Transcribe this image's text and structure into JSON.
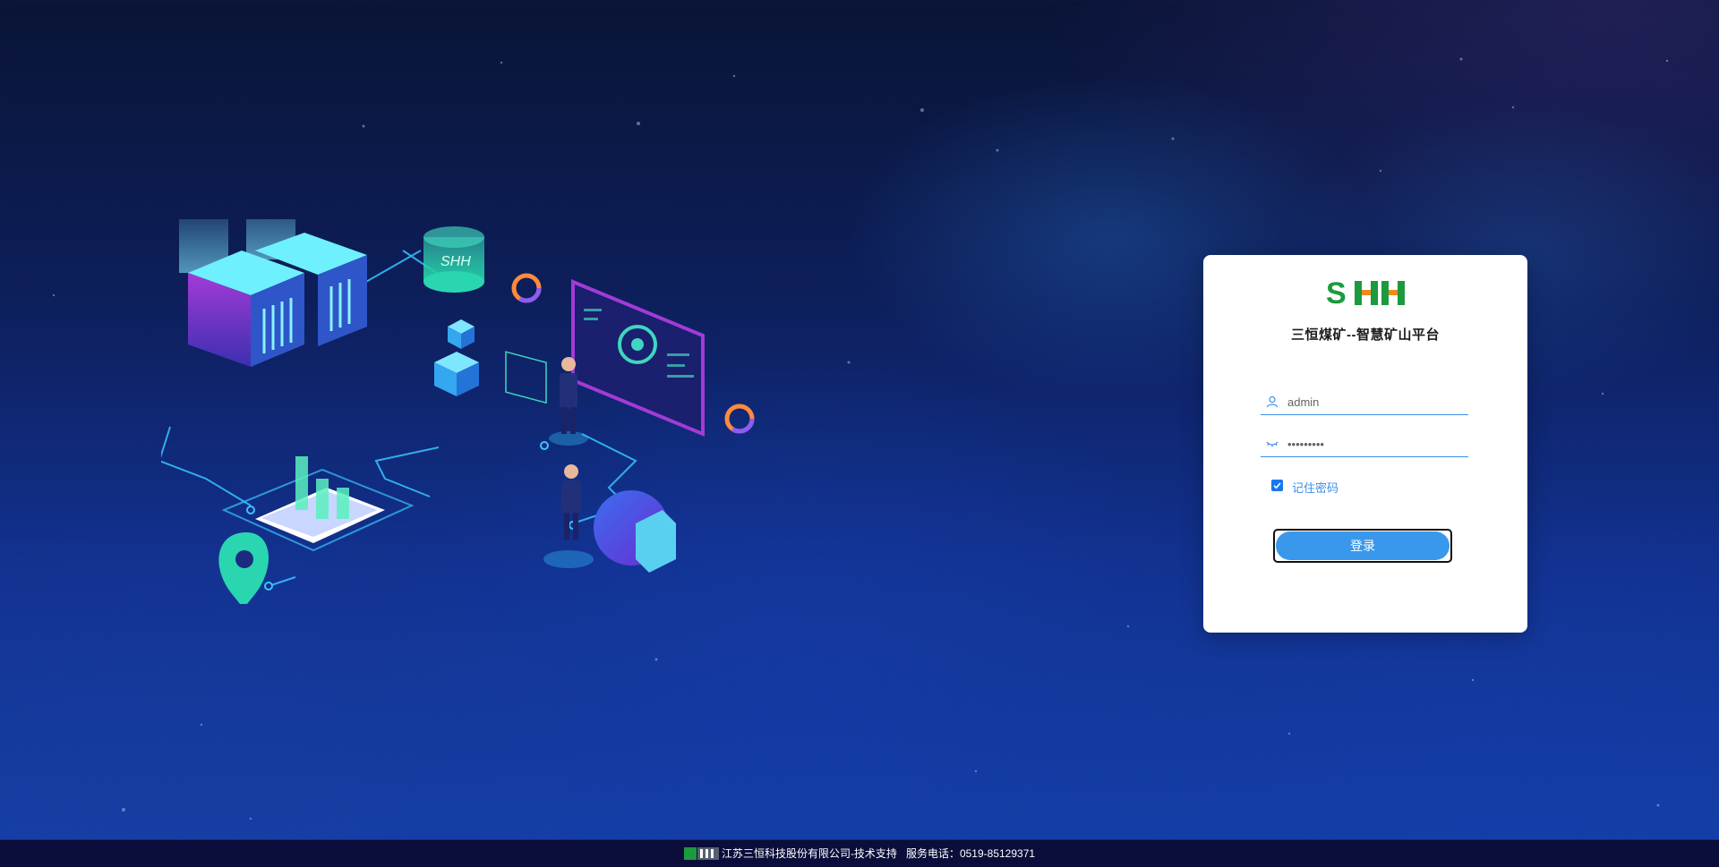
{
  "brand": {
    "logo_text": "SHH",
    "platform_title": "三恒煤矿--智慧矿山平台",
    "colors": {
      "logo_green": "#1c9a3e",
      "logo_orange": "#f08a1c",
      "accent_blue": "#3a98ec"
    }
  },
  "login_form": {
    "username_value": "admin",
    "password_value": "•••••••••",
    "remember_label": "记住密码",
    "remember_checked": true,
    "submit_label": "登录"
  },
  "illustration": {
    "cylinder_label": "SHH"
  },
  "footer": {
    "company": "江苏三恒科技股份有限公司-技术支持",
    "phone_label": "服务电话：",
    "phone_number": "0519-85129371"
  }
}
